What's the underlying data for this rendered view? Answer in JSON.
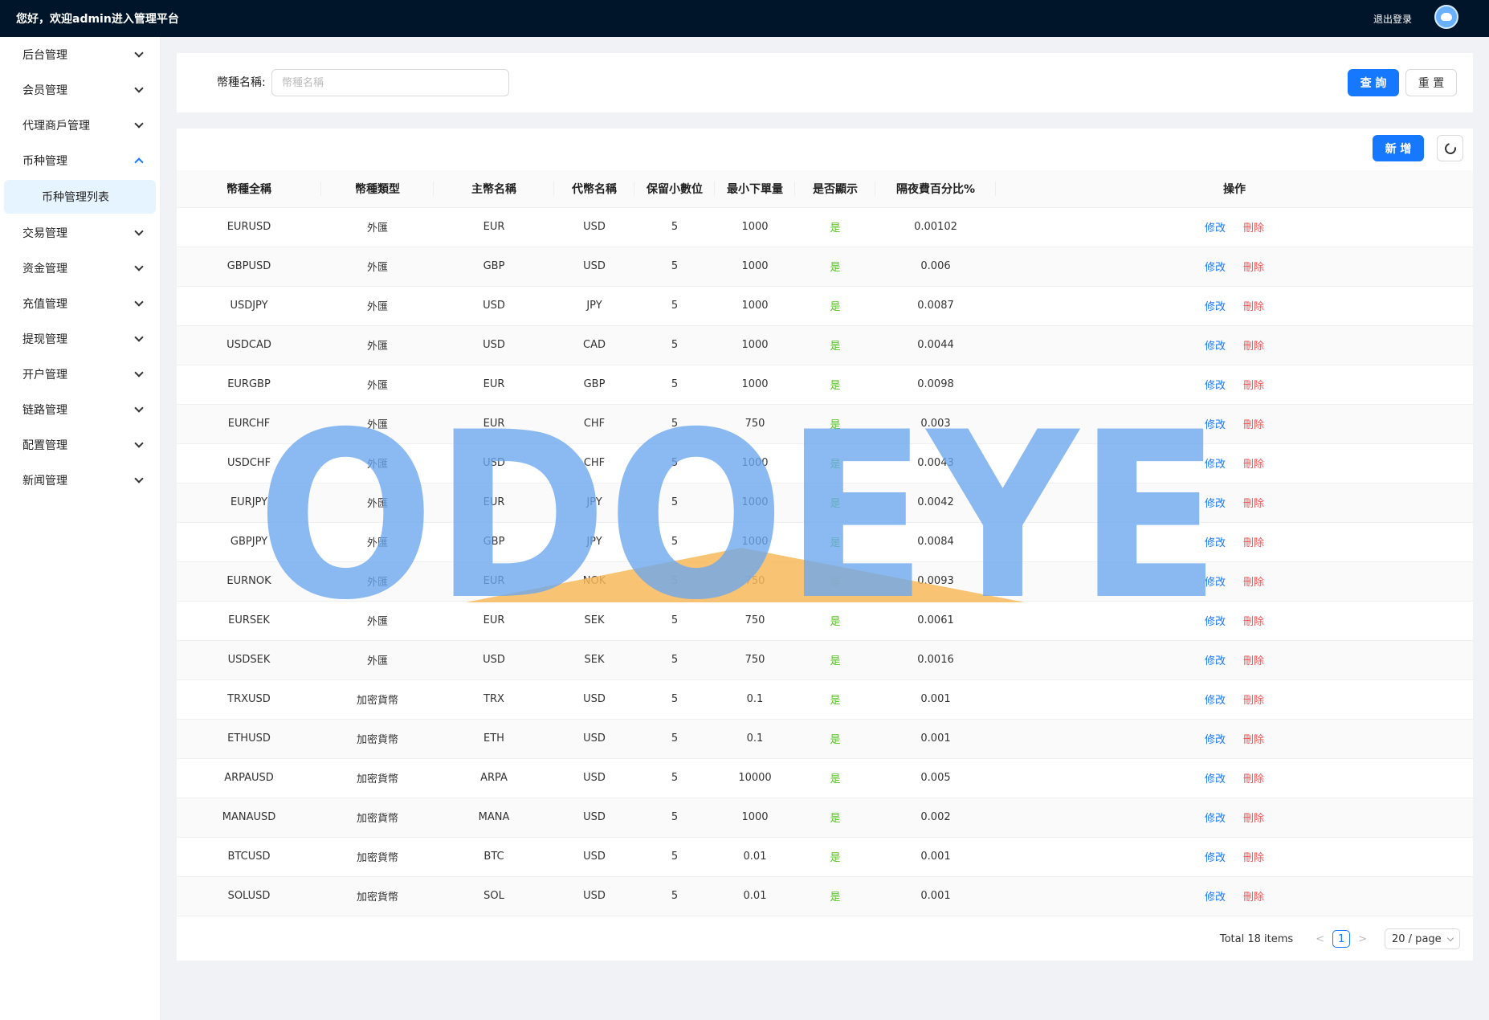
{
  "header": {
    "greeting": "您好，欢迎admin进入管理平台",
    "logout_label": "退出登录",
    "avatar_icon": "robot-avatar-icon"
  },
  "sidebar": {
    "items": [
      {
        "label": "后台管理"
      },
      {
        "label": "会员管理"
      },
      {
        "label": "代理商戶管理"
      },
      {
        "label": "币种管理",
        "expanded": true
      },
      {
        "label": "交易管理"
      },
      {
        "label": "资金管理"
      },
      {
        "label": "充值管理"
      },
      {
        "label": "提现管理"
      },
      {
        "label": "开户管理"
      },
      {
        "label": "链路管理"
      },
      {
        "label": "配置管理"
      },
      {
        "label": "新闻管理"
      }
    ],
    "submenu_active": "币种管理列表"
  },
  "search": {
    "label": "幣種名稱:",
    "placeholder": "幣種名稱",
    "value": "",
    "query_label": "查 詢",
    "reset_label": "重 置"
  },
  "toolbar": {
    "add_label": "新 增",
    "refresh_icon": "refresh-icon"
  },
  "table": {
    "columns": [
      "幣種全稱",
      "幣種類型",
      "主幣名稱",
      "代幣名稱",
      "保留小數位",
      "最小下單量",
      "是否顯示",
      "隔夜費百分比%",
      "操作"
    ],
    "edit_label": "修改",
    "delete_label": "刪除",
    "rows": [
      {
        "full": "EURUSD",
        "type": "外匯",
        "main": "EUR",
        "token": "USD",
        "decimals": "5",
        "min": "1000",
        "show": "是",
        "fee": "0.00102"
      },
      {
        "full": "GBPUSD",
        "type": "外匯",
        "main": "GBP",
        "token": "USD",
        "decimals": "5",
        "min": "1000",
        "show": "是",
        "fee": "0.006"
      },
      {
        "full": "USDJPY",
        "type": "外匯",
        "main": "USD",
        "token": "JPY",
        "decimals": "5",
        "min": "1000",
        "show": "是",
        "fee": "0.0087"
      },
      {
        "full": "USDCAD",
        "type": "外匯",
        "main": "USD",
        "token": "CAD",
        "decimals": "5",
        "min": "1000",
        "show": "是",
        "fee": "0.0044"
      },
      {
        "full": "EURGBP",
        "type": "外匯",
        "main": "EUR",
        "token": "GBP",
        "decimals": "5",
        "min": "1000",
        "show": "是",
        "fee": "0.0098"
      },
      {
        "full": "EURCHF",
        "type": "外匯",
        "main": "EUR",
        "token": "CHF",
        "decimals": "5",
        "min": "750",
        "show": "是",
        "fee": "0.003"
      },
      {
        "full": "USDCHF",
        "type": "外匯",
        "main": "USD",
        "token": "CHF",
        "decimals": "5",
        "min": "1000",
        "show": "是",
        "fee": "0.0043"
      },
      {
        "full": "EURJPY",
        "type": "外匯",
        "main": "EUR",
        "token": "JPY",
        "decimals": "5",
        "min": "1000",
        "show": "是",
        "fee": "0.0042"
      },
      {
        "full": "GBPJPY",
        "type": "外匯",
        "main": "GBP",
        "token": "JPY",
        "decimals": "5",
        "min": "1000",
        "show": "是",
        "fee": "0.0084"
      },
      {
        "full": "EURNOK",
        "type": "外匯",
        "main": "EUR",
        "token": "NOK",
        "decimals": "5",
        "min": "750",
        "show": "是",
        "fee": "0.0093"
      },
      {
        "full": "EURSEK",
        "type": "外匯",
        "main": "EUR",
        "token": "SEK",
        "decimals": "5",
        "min": "750",
        "show": "是",
        "fee": "0.0061"
      },
      {
        "full": "USDSEK",
        "type": "外匯",
        "main": "USD",
        "token": "SEK",
        "decimals": "5",
        "min": "750",
        "show": "是",
        "fee": "0.0016"
      },
      {
        "full": "TRXUSD",
        "type": "加密貨幣",
        "main": "TRX",
        "token": "USD",
        "decimals": "5",
        "min": "0.1",
        "show": "是",
        "fee": "0.001"
      },
      {
        "full": "ETHUSD",
        "type": "加密貨幣",
        "main": "ETH",
        "token": "USD",
        "decimals": "5",
        "min": "0.1",
        "show": "是",
        "fee": "0.001"
      },
      {
        "full": "ARPAUSD",
        "type": "加密貨幣",
        "main": "ARPA",
        "token": "USD",
        "decimals": "5",
        "min": "10000",
        "show": "是",
        "fee": "0.005"
      },
      {
        "full": "MANAUSD",
        "type": "加密貨幣",
        "main": "MANA",
        "token": "USD",
        "decimals": "5",
        "min": "1000",
        "show": "是",
        "fee": "0.002"
      },
      {
        "full": "BTCUSD",
        "type": "加密貨幣",
        "main": "BTC",
        "token": "USD",
        "decimals": "5",
        "min": "0.01",
        "show": "是",
        "fee": "0.001"
      },
      {
        "full": "SOLUSD",
        "type": "加密貨幣",
        "main": "SOL",
        "token": "USD",
        "decimals": "5",
        "min": "0.01",
        "show": "是",
        "fee": "0.001"
      }
    ]
  },
  "pagination": {
    "total_text": "Total 18 items",
    "current_page": "1",
    "page_size": "20 / page"
  },
  "watermark": {
    "text": "ODOEYE"
  },
  "colors": {
    "header_bg": "#001529",
    "primary": "#1677ff",
    "danger": "#ff4d4f",
    "success": "#52c41a",
    "watermark_blue": "#6aa6ee",
    "watermark_orange": "#f7b85a"
  }
}
